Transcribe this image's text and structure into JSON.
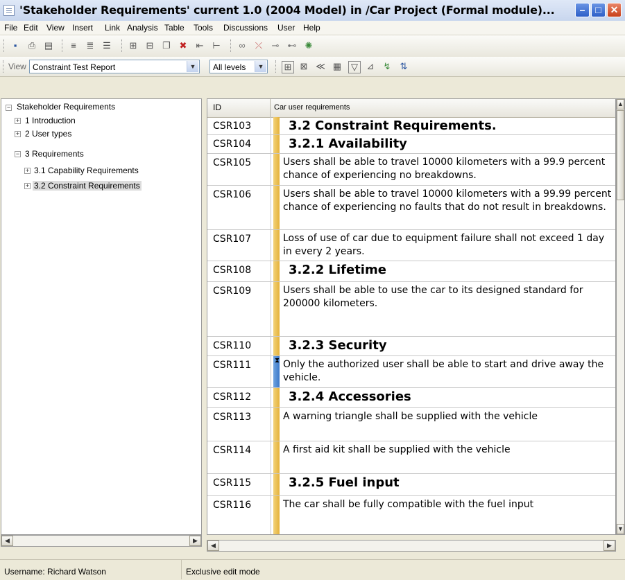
{
  "window": {
    "title": "'Stakeholder Requirements' current 1.0 (2004 Model) in /Car Project (Formal module)...",
    "min_glyph": "–",
    "max_glyph": "□",
    "close_glyph": "✕"
  },
  "menu": [
    "File",
    "Edit",
    "View",
    "Insert",
    "Link",
    "Analysis",
    "Table",
    "Tools",
    "Discussions",
    "User",
    "Help"
  ],
  "toolbar2": {
    "view_label": "View",
    "view_value": "Constraint Test Report",
    "levels_value": "All levels"
  },
  "tree": {
    "root": "Stakeholder Requirements",
    "items": [
      {
        "label": "1 Introduction"
      },
      {
        "label": "2 User types"
      },
      {
        "label": "3 Requirements"
      },
      {
        "label": "3.1 Capability Requirements"
      },
      {
        "label": "3.2 Constraint Requirements"
      }
    ]
  },
  "grid": {
    "col_id": "ID",
    "col_text": "Car user requirements",
    "rows": [
      {
        "id": "CSR103",
        "heading": "3.2 Constraint Requirements."
      },
      {
        "id": "CSR104",
        "heading": "3.2.1 Availability"
      },
      {
        "id": "CSR105",
        "text": "Users shall be able to travel 10000 kilometers with a 99.9 percent chance of experiencing no breakdowns."
      },
      {
        "id": "CSR106",
        "text": "Users shall be able to travel 10000 kilometers with a 99.99 percent chance of experiencing no faults that do not result in breakdowns."
      },
      {
        "id": "CSR107",
        "text": "Loss of use of car due to equipment failure shall not exceed 1 day in every 2 years."
      },
      {
        "id": "CSR108",
        "heading": "3.2.2 Lifetime"
      },
      {
        "id": "CSR109",
        "text": "Users shall be able to use the car to its designed standard for 200000 kilometers."
      },
      {
        "id": "CSR110",
        "heading": "3.2.3 Security"
      },
      {
        "id": "CSR111",
        "text": "Only the authorized user shall be able to start and drive away the vehicle."
      },
      {
        "id": "CSR112",
        "heading": "3.2.4 Accessories"
      },
      {
        "id": "CSR113",
        "text": "A warning triangle shall be supplied with the vehicle"
      },
      {
        "id": "CSR114",
        "text": "A first aid kit shall be supplied with the vehicle"
      },
      {
        "id": "CSR115",
        "heading": "3.2.5 Fuel input"
      },
      {
        "id": "CSR116",
        "text": "The car shall be fully compatible with the fuel input"
      }
    ]
  },
  "status": {
    "username": "Username: Richard Watson",
    "mode": "Exclusive edit mode"
  },
  "colors": {
    "requirement_bar": "#e5b23a",
    "selected_bar": "#3b78c8"
  }
}
